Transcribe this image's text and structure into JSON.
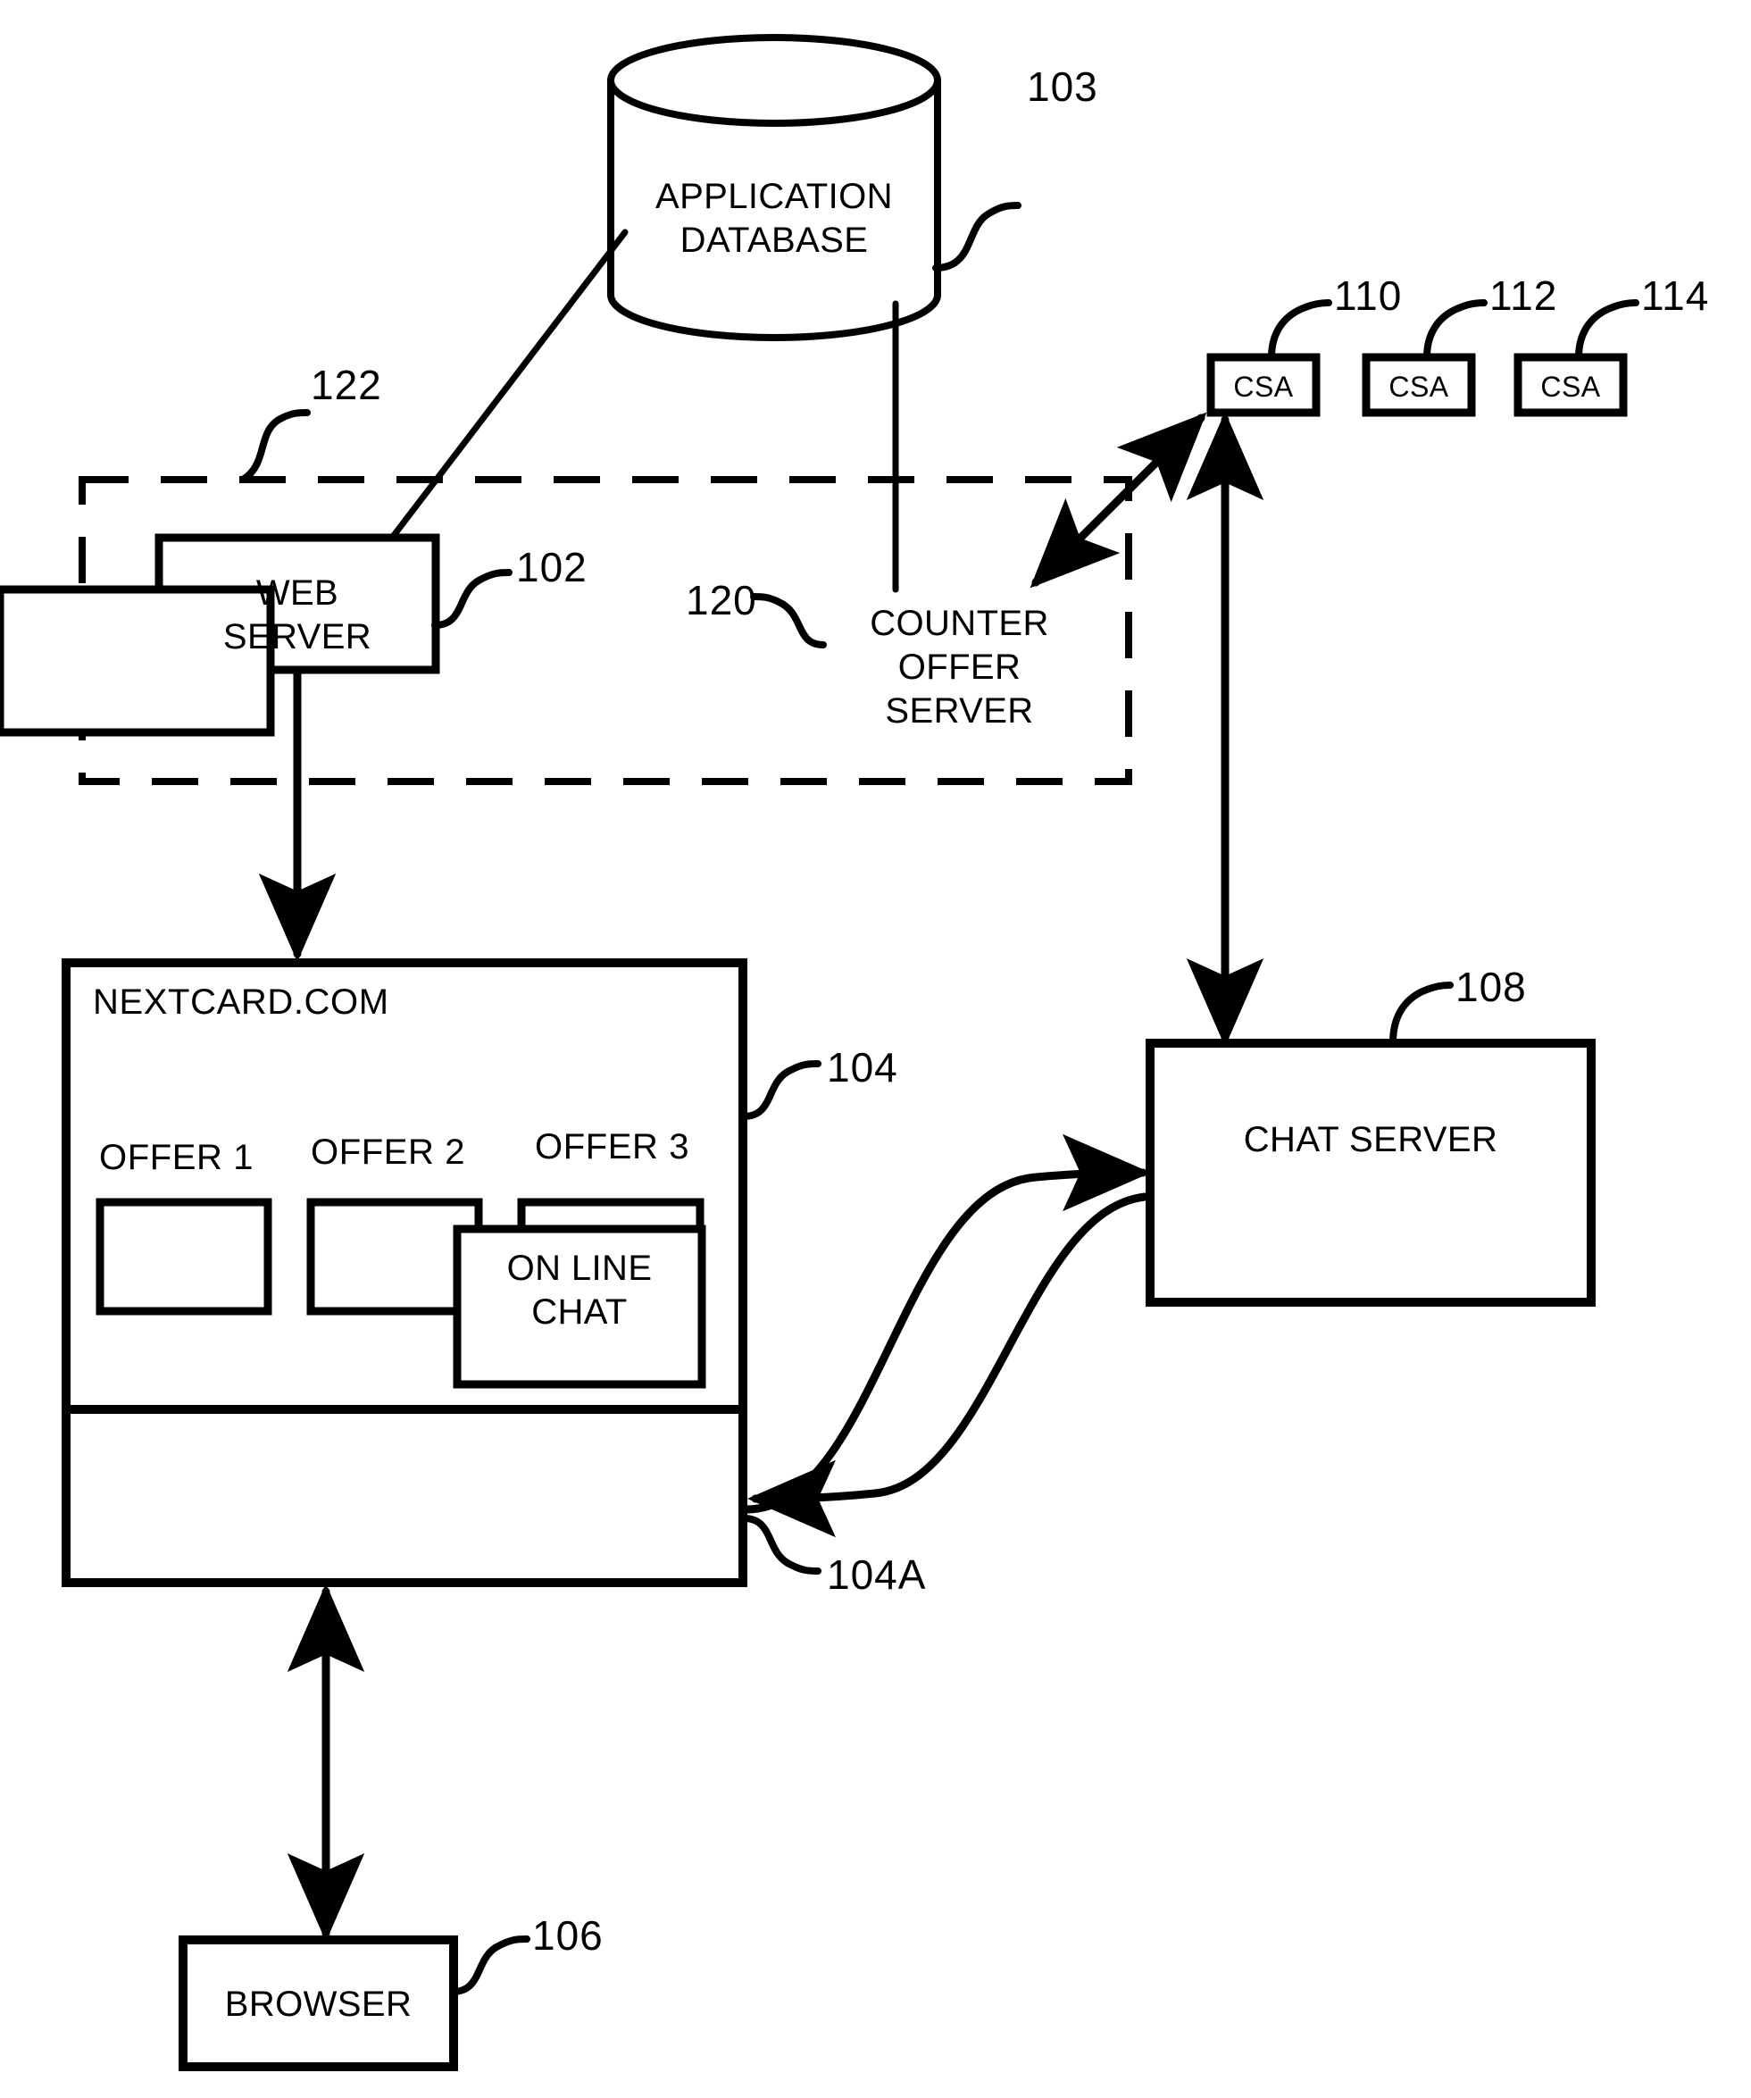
{
  "figure": {
    "type": "patent-block-diagram",
    "background_color": "#ffffff",
    "line_color": "#000000"
  },
  "nodes": {
    "application_database": {
      "label": "APPLICATION\nDATABASE",
      "ref": "103",
      "shape": "cylinder"
    },
    "web_server": {
      "label": "WEB\nSERVER",
      "ref": "102",
      "shape": "rect"
    },
    "counter_offer_server": {
      "label": "COUNTER\nOFFER\nSERVER",
      "ref": "120",
      "shape": "rect"
    },
    "chat_server": {
      "label": "CHAT SERVER",
      "ref": "108",
      "shape": "rect"
    },
    "browser": {
      "label": "BROWSER",
      "ref": "106",
      "shape": "rect"
    },
    "boundary": {
      "ref": "122",
      "shape": "dashed-rect"
    },
    "web_page": {
      "ref": "104",
      "shape": "rect"
    },
    "chat_pane": {
      "ref": "104A",
      "shape": "rect"
    }
  },
  "csa_nodes": [
    {
      "label": "CSA",
      "ref": "110"
    },
    {
      "label": "CSA",
      "ref": "112"
    },
    {
      "label": "CSA",
      "ref": "114"
    }
  ],
  "web_page": {
    "title": "NEXTCARD.COM",
    "offers": [
      {
        "label": "OFFER 1"
      },
      {
        "label": "OFFER 2"
      },
      {
        "label": "OFFER 3"
      }
    ],
    "chat_button": {
      "label": "ON LINE\nCHAT"
    }
  }
}
